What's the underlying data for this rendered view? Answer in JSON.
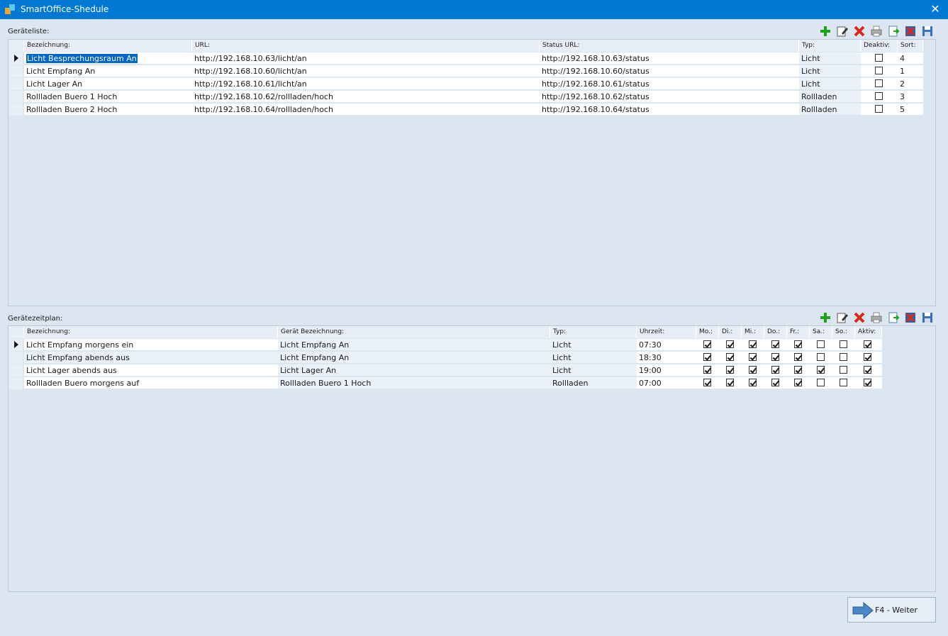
{
  "window": {
    "title": "SmartOffice-Shedule",
    "close_glyph": "✕"
  },
  "devices": {
    "label": "Geräteliste:",
    "columns": [
      "Bezeichnung:",
      "URL:",
      "Status URL:",
      "Typ:",
      "Deaktiv:",
      "Sort:"
    ],
    "rows": [
      {
        "name": "Licht Besprechungsraum An",
        "url": "http://192.168.10.63/licht/an",
        "status_url": "http://192.168.10.63/status",
        "type": "Licht",
        "deactivated": false,
        "sort": "4"
      },
      {
        "name": "Licht Empfang An",
        "url": "http://192.168.10.60/licht/an",
        "status_url": "http://192.168.10.60/status",
        "type": "Licht",
        "deactivated": false,
        "sort": "1"
      },
      {
        "name": "Licht Lager An",
        "url": "http://192.168.10.61/licht/an",
        "status_url": "http://192.168.10.61/status",
        "type": "Licht",
        "deactivated": false,
        "sort": "2"
      },
      {
        "name": "Rollladen Buero 1 Hoch",
        "url": "http://192.168.10.62/rollladen/hoch",
        "status_url": "http://192.168.10.62/status",
        "type": "Rollladen",
        "deactivated": false,
        "sort": "3"
      },
      {
        "name": "Rollladen Buero 2 Hoch",
        "url": "http://192.168.10.64/rollladen/hoch",
        "status_url": "http://192.168.10.64/status",
        "type": "Rollladen",
        "deactivated": false,
        "sort": "5"
      }
    ]
  },
  "schedule": {
    "label": "Gerätezeitplan:",
    "columns": [
      "Bezeichnung:",
      "Gerät Bezeichnung:",
      "Typ:",
      "Uhrzeit:",
      "Mo.:",
      "Di.:",
      "Mi.:",
      "Do.:",
      "Fr.:",
      "Sa.:",
      "So.:",
      "Aktiv:"
    ],
    "rows": [
      {
        "name": "Licht Empfang morgens ein",
        "device": "Licht Empfang An",
        "type": "Licht",
        "time": "07:30",
        "days": [
          true,
          true,
          true,
          true,
          true,
          false,
          false
        ],
        "active": true
      },
      {
        "name": "Licht Empfang abends aus",
        "device": "Licht Empfang An",
        "type": "Licht",
        "time": "18:30",
        "days": [
          true,
          true,
          true,
          true,
          true,
          false,
          false
        ],
        "active": true
      },
      {
        "name": "Licht Lager abends aus",
        "device": "Licht Lager An",
        "type": "Licht",
        "time": "19:00",
        "days": [
          true,
          true,
          true,
          true,
          true,
          true,
          false
        ],
        "active": true
      },
      {
        "name": "Rollladen Buero morgens auf",
        "device": "Rollladen Buero 1 Hoch",
        "type": "Rollladen",
        "time": "07:00",
        "days": [
          true,
          true,
          true,
          true,
          true,
          false,
          false
        ],
        "active": true
      }
    ]
  },
  "toolbar_icons": [
    "add-icon",
    "edit-icon",
    "delete-icon",
    "print-icon",
    "export-icon",
    "clear-icon",
    "save-icon"
  ],
  "next_button": {
    "label": "F4 - Weiter"
  },
  "colors": {
    "titlebar": "#0078d4",
    "background": "#dce6f0",
    "selection": "#0066cc"
  }
}
